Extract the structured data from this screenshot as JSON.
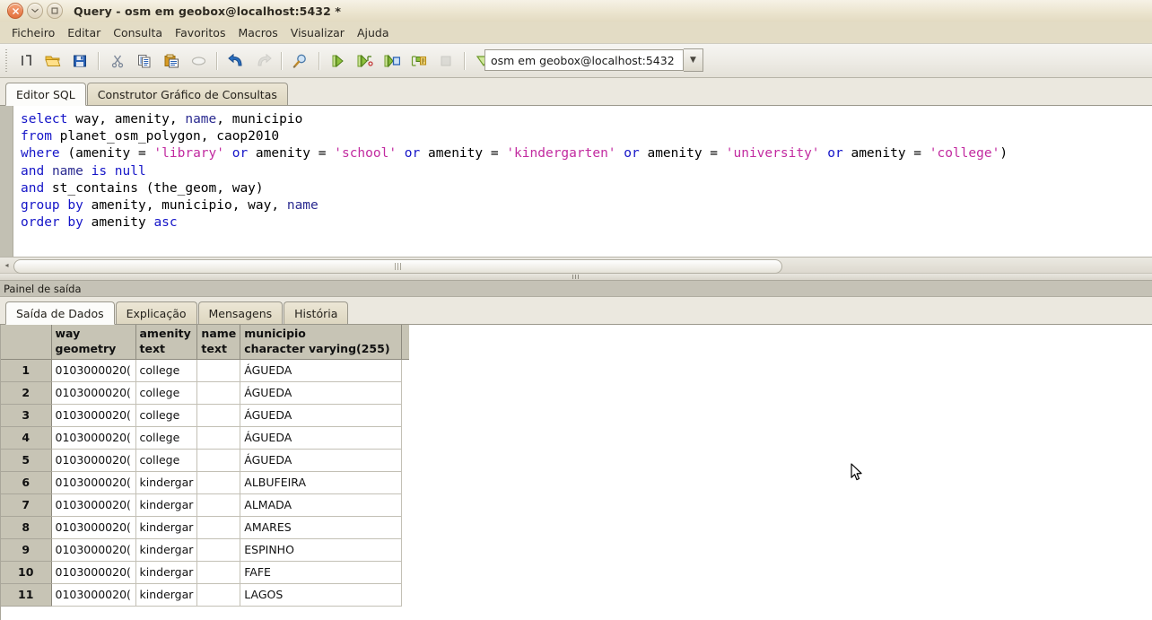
{
  "window": {
    "title": "Query - osm em geobox@localhost:5432 *",
    "buttons": {
      "close": "×",
      "minimize": "⌄",
      "maximize": "□"
    }
  },
  "menubar": {
    "items": [
      {
        "label": "Ficheiro"
      },
      {
        "label": "Editar"
      },
      {
        "label": "Consulta"
      },
      {
        "label": "Favoritos"
      },
      {
        "label": "Macros"
      },
      {
        "label": "Visualizar"
      },
      {
        "label": "Ajuda"
      }
    ]
  },
  "toolbar": {
    "buttons": [
      {
        "name": "new-query-icon",
        "title": "Nova janela de consulta"
      },
      {
        "name": "open-file-icon",
        "title": "Abrir ficheiro"
      },
      {
        "name": "save-icon",
        "title": "Guardar"
      },
      {
        "name": "cut-icon",
        "title": "Cortar"
      },
      {
        "name": "copy-icon",
        "title": "Copiar"
      },
      {
        "name": "paste-icon",
        "title": "Colar"
      },
      {
        "name": "clear-icon",
        "title": "Limpar janela"
      },
      {
        "name": "undo-icon",
        "title": "Desfazer"
      },
      {
        "name": "redo-icon",
        "title": "Refazer"
      },
      {
        "name": "find-replace-icon",
        "title": "Procurar e substituir"
      },
      {
        "name": "execute-query-icon",
        "title": "Executar consulta"
      },
      {
        "name": "execute-to-file-icon",
        "title": "Executar para ficheiro"
      },
      {
        "name": "explain-query-icon",
        "title": "Explicar consulta"
      },
      {
        "name": "explain-analyze-icon",
        "title": "Explicar analisar"
      },
      {
        "name": "cancel-query-icon",
        "title": "Cancelar"
      },
      {
        "name": "query-builder-icon",
        "title": "Construtor de consultas"
      }
    ],
    "connection": {
      "value": "osm em geobox@localhost:5432",
      "arrow": "▼"
    }
  },
  "editor_tabs": {
    "items": [
      {
        "label": "Editor SQL",
        "active": true
      },
      {
        "label": "Construtor Gráfico de Consultas",
        "active": false
      }
    ]
  },
  "sql": {
    "lines": [
      [
        {
          "t": "select",
          "c": "kw"
        },
        {
          "t": " way, amenity, ",
          "c": "id"
        },
        {
          "t": "name",
          "c": "col"
        },
        {
          "t": ", municipio",
          "c": "id"
        }
      ],
      [
        {
          "t": "from",
          "c": "kw"
        },
        {
          "t": " planet_osm_polygon, caop2010",
          "c": "id"
        }
      ],
      [
        {
          "t": "where",
          "c": "kw"
        },
        {
          "t": " (amenity = ",
          "c": "id"
        },
        {
          "t": "'library'",
          "c": "str"
        },
        {
          "t": " or",
          "c": "kw"
        },
        {
          "t": " amenity = ",
          "c": "id"
        },
        {
          "t": "'school'",
          "c": "str"
        },
        {
          "t": " or",
          "c": "kw"
        },
        {
          "t": " amenity = ",
          "c": "id"
        },
        {
          "t": "'kindergarten'",
          "c": "str"
        },
        {
          "t": " or",
          "c": "kw"
        },
        {
          "t": " amenity = ",
          "c": "id"
        },
        {
          "t": "'university'",
          "c": "str"
        },
        {
          "t": " or",
          "c": "kw"
        },
        {
          "t": " amenity = ",
          "c": "id"
        },
        {
          "t": "'college'",
          "c": "str"
        },
        {
          "t": ")",
          "c": "id"
        }
      ],
      [
        {
          "t": "and",
          "c": "kw"
        },
        {
          "t": " ",
          "c": "id"
        },
        {
          "t": "name",
          "c": "col"
        },
        {
          "t": " ",
          "c": "id"
        },
        {
          "t": "is",
          "c": "kw"
        },
        {
          "t": " ",
          "c": "id"
        },
        {
          "t": "null",
          "c": "kw"
        }
      ],
      [
        {
          "t": "and",
          "c": "kw"
        },
        {
          "t": " st_contains (the_geom, way)",
          "c": "id"
        }
      ],
      [
        {
          "t": "group",
          "c": "kw"
        },
        {
          "t": " ",
          "c": "id"
        },
        {
          "t": "by",
          "c": "kw"
        },
        {
          "t": " amenity, municipio, way, ",
          "c": "id"
        },
        {
          "t": "name",
          "c": "col"
        }
      ],
      [
        {
          "t": "order",
          "c": "kw"
        },
        {
          "t": " ",
          "c": "id"
        },
        {
          "t": "by",
          "c": "kw"
        },
        {
          "t": " amenity ",
          "c": "id"
        },
        {
          "t": "asc",
          "c": "kw"
        }
      ]
    ],
    "plain": "select way, amenity, name, municipio\nfrom planet_osm_polygon, caop2010\nwhere (amenity = 'library' or amenity = 'school' or amenity = 'kindergarten' or amenity = 'university' or amenity = 'college')\nand name is null\nand st_contains (the_geom, way)\ngroup by amenity, municipio, way, name\norder by amenity asc"
  },
  "output_panel": {
    "title": "Painel de saída",
    "tabs": [
      {
        "label": "Saída de Dados",
        "active": true
      },
      {
        "label": "Explicação",
        "active": false
      },
      {
        "label": "Mensagens",
        "active": false
      },
      {
        "label": "História",
        "active": false
      }
    ]
  },
  "grid": {
    "columns": [
      {
        "name": "",
        "type": ""
      },
      {
        "name": "way",
        "type": "geometry"
      },
      {
        "name": "amenity",
        "type": "text"
      },
      {
        "name": "name",
        "type": "text"
      },
      {
        "name": "municipio",
        "type": "character varying(255)"
      }
    ],
    "rows": [
      {
        "n": "1",
        "way": "0103000020(",
        "amenity": "college",
        "name": "",
        "municipio": "ÁGUEDA"
      },
      {
        "n": "2",
        "way": "0103000020(",
        "amenity": "college",
        "name": "",
        "municipio": "ÁGUEDA"
      },
      {
        "n": "3",
        "way": "0103000020(",
        "amenity": "college",
        "name": "",
        "municipio": "ÁGUEDA"
      },
      {
        "n": "4",
        "way": "0103000020(",
        "amenity": "college",
        "name": "",
        "municipio": "ÁGUEDA"
      },
      {
        "n": "5",
        "way": "0103000020(",
        "amenity": "college",
        "name": "",
        "municipio": "ÁGUEDA"
      },
      {
        "n": "6",
        "way": "0103000020(",
        "amenity": "kindergar",
        "name": "",
        "municipio": "ALBUFEIRA"
      },
      {
        "n": "7",
        "way": "0103000020(",
        "amenity": "kindergar",
        "name": "",
        "municipio": "ALMADA"
      },
      {
        "n": "8",
        "way": "0103000020(",
        "amenity": "kindergar",
        "name": "",
        "municipio": "AMARES"
      },
      {
        "n": "9",
        "way": "0103000020(",
        "amenity": "kindergar",
        "name": "",
        "municipio": "ESPINHO"
      },
      {
        "n": "10",
        "way": "0103000020(",
        "amenity": "kindergar",
        "name": "",
        "municipio": "FAFE"
      },
      {
        "n": "11",
        "way": "0103000020(",
        "amenity": "kindergar",
        "name": "",
        "municipio": "LAGOS"
      }
    ]
  },
  "scrollbars": {
    "editor_h_left_arrow": "◂",
    "editor_h_right_arrow": "▸"
  },
  "colors": {
    "titlebar": "#e5dcc4",
    "menubar": "#e3dcc5",
    "toolbar": "#eeece6",
    "keyword": "#1515c8",
    "string": "#c22ba0",
    "grid_header": "#c7c4b5",
    "close_button": "#e4713e"
  }
}
